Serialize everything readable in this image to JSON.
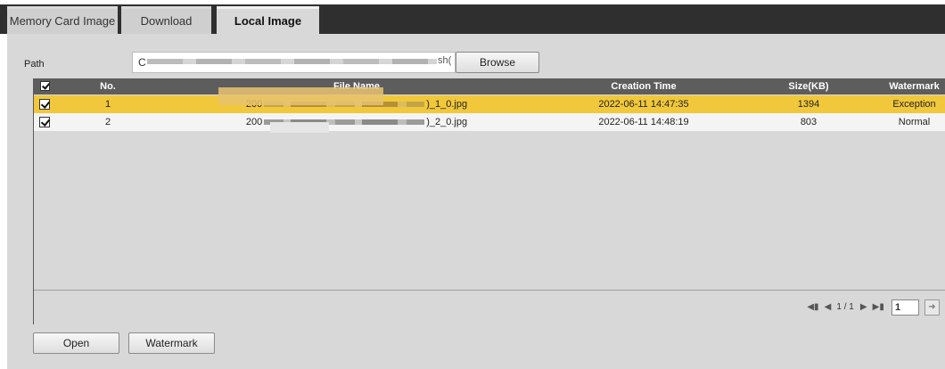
{
  "tabs": [
    {
      "label": "Memory Card Image"
    },
    {
      "label": "Download"
    },
    {
      "label": "Local Image"
    }
  ],
  "path": {
    "label": "Path",
    "value_prefix": "C",
    "value_suffix": "sh("
  },
  "browse_label": "Browse",
  "grid": {
    "columns": {
      "no": "No.",
      "file_name": "File Name",
      "creation_time": "Creation Time",
      "size": "Size(KB)",
      "watermark": "Watermark"
    },
    "rows": [
      {
        "checked": true,
        "no": "1",
        "file_prefix": "200",
        "file_suffix": ")_1_0.jpg",
        "creation_time": "2022-06-11 14:47:35",
        "size": "1394",
        "watermark": "Exception"
      },
      {
        "checked": true,
        "no": "2",
        "file_prefix": "200",
        "file_suffix": ")_2_0.jpg",
        "creation_time": "2022-06-11 14:48:19",
        "size": "803",
        "watermark": "Normal"
      }
    ]
  },
  "pager": {
    "first": "first-page-icon",
    "prev": "prev-page-icon",
    "page_text": "1 / 1",
    "next": "next-page-icon",
    "last": "last-page-icon",
    "page_input": "1",
    "go": "go-arrow-icon"
  },
  "buttons": {
    "open": "Open",
    "watermark": "Watermark"
  },
  "colors": {
    "selected_row": "#f1c83b",
    "header_bg": "#5d5d5d",
    "panel_bg": "#d8d8d8",
    "tabbar_bg": "#2f2f2f"
  }
}
